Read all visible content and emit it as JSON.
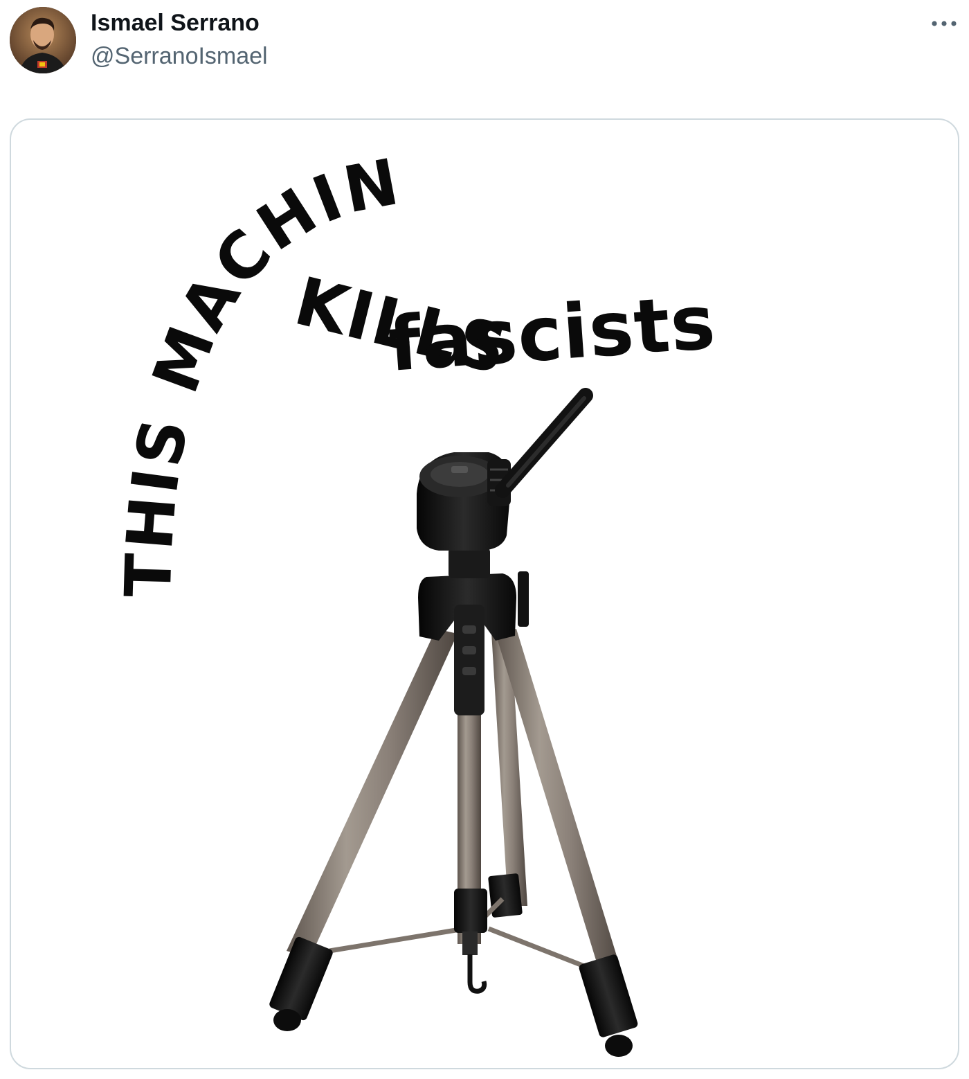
{
  "tweet": {
    "author": {
      "display_name": "Ismael Serrano",
      "handle": "@SerranoIsmael",
      "avatar": "user-avatar-photo"
    },
    "more_icon": "more-horizontal-icon",
    "media": {
      "slogan": {
        "line1": "THIS MACHINE",
        "line2": "KILLS",
        "line3": "fascists"
      },
      "illustration": "camera-tripod"
    }
  },
  "colors": {
    "text_primary": "#0f1419",
    "text_secondary": "#536471",
    "border": "#cfd9de",
    "ink": "#0a0a0a",
    "tripod_leg": "#8a8078",
    "tripod_black": "#151515"
  }
}
